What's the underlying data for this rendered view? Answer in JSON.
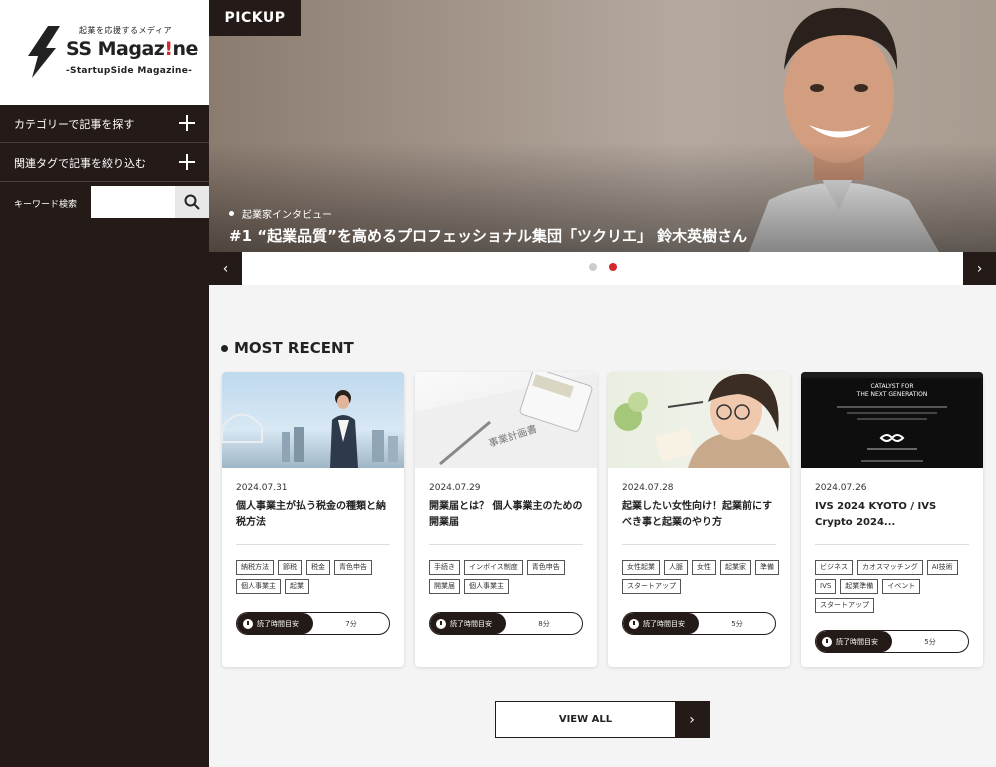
{
  "logo": {
    "tagline": "起業を応援するメディア",
    "title_main": "SS Magaz",
    "title_bang": "!",
    "title_end": "ne",
    "subtitle": "-StartupSide Magazine-"
  },
  "sidebar": {
    "category_label": "カテゴリーで記事を探す",
    "tag_label": "関連タグで記事を絞り込む",
    "keyword_label": "キーワード検索",
    "keyword_placeholder": ""
  },
  "pickup": {
    "badge": "PICKUP",
    "category": "起業家インタビュー",
    "title": "#1 “起業品質”を高めるプロフェッショナル集団「ツクリエ」 鈴木英樹さん",
    "prev_icon": "‹",
    "next_icon": "›",
    "slides_total": 2,
    "active_slide": 2
  },
  "colors": {
    "dark": "#241a17",
    "accent": "#d8262f"
  },
  "most_recent": {
    "title": "MOST RECENT",
    "read_label": "読了時間目安",
    "articles": [
      {
        "date": "2024.07.31",
        "title": "個人事業主が払う税金の種類と納税方法",
        "tags": [
          "納税方法",
          "節税",
          "税金",
          "青色申告",
          "個人事業主",
          "起業"
        ],
        "read_time": "7分"
      },
      {
        "date": "2024.07.29",
        "title": "開業届とは？ 個人事業主のための開業届",
        "tags": [
          "手続き",
          "インボイス制度",
          "青色申告",
          "開業届",
          "個人事業主"
        ],
        "read_time": "8分"
      },
      {
        "date": "2024.07.28",
        "title": "起業したい女性向け！起業前にすべき事と起業のやり方",
        "tags": [
          "女性起業",
          "人脈",
          "女性",
          "起業家",
          "準備",
          "スタートアップ"
        ],
        "read_time": "5分"
      },
      {
        "date": "2024.07.26",
        "title": "IVS 2024 KYOTO / IVS Crypto 2024...",
        "tags": [
          "ビジネス",
          "カオスマッチング",
          "AI技術",
          "IVS",
          "起業準備",
          "イベント",
          "スタートアップ"
        ],
        "read_time": "5分"
      }
    ],
    "view_all": "VIEW ALL",
    "view_all_icon": "›"
  },
  "thumb4": {
    "line1": "CATALYST FOR",
    "line2": "THE NEXT GENERATION"
  }
}
